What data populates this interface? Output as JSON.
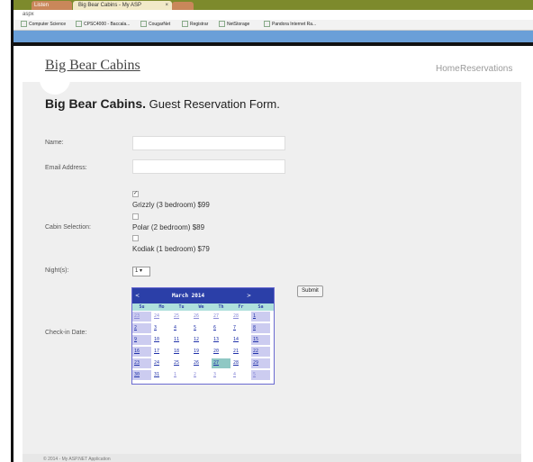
{
  "browser": {
    "tab_left_label": "Listen",
    "tab_active_label": "Big Bear Cabins - My ASP",
    "tab_close": "×",
    "url_text": "aspx",
    "favorites": [
      {
        "label": "Computer Science"
      },
      {
        "label": "CPSC4000 - Baccala..."
      },
      {
        "label": "CougarNet"
      },
      {
        "label": "Registrar"
      },
      {
        "label": "NetStorage"
      },
      {
        "label": "Pandora Internet Ra..."
      }
    ]
  },
  "site": {
    "title": "Big Bear Cabins",
    "nav": {
      "home": "Home",
      "reservations": "Reservations"
    }
  },
  "form": {
    "heading_bold": "Big Bear Cabins.",
    "heading_rest": " Guest Reservation Form.",
    "name_label": "Name:",
    "email_label": "Email Address:",
    "cabin_label": "Cabin Selection:",
    "cabins": [
      {
        "label": "Grizzly (3 bedroom) $99",
        "checked": true
      },
      {
        "label": "Polar (2 bedroom) $89",
        "checked": false
      },
      {
        "label": "Kodiak (1 bedroom) $79",
        "checked": false
      }
    ],
    "nights_label": "Night(s):",
    "nights_value": "1 ▾",
    "checkin_label": "Check-in Date:",
    "submit_label": "Submit"
  },
  "calendar": {
    "prev": "<",
    "next": ">",
    "title": "March 2014",
    "dows": [
      "Su",
      "Mo",
      "Tu",
      "We",
      "Th",
      "Fr",
      "Sa"
    ],
    "weeks": [
      [
        "23",
        "24",
        "25",
        "26",
        "27",
        "28",
        "1"
      ],
      [
        "2",
        "3",
        "4",
        "5",
        "6",
        "7",
        "8"
      ],
      [
        "9",
        "10",
        "11",
        "12",
        "13",
        "14",
        "15"
      ],
      [
        "16",
        "17",
        "18",
        "19",
        "20",
        "21",
        "22"
      ],
      [
        "23",
        "24",
        "25",
        "26",
        "27",
        "28",
        "29"
      ],
      [
        "30",
        "31",
        "1",
        "2",
        "3",
        "4",
        "5"
      ]
    ],
    "today": "27"
  },
  "footer": {
    "text": "© 2014 - My ASP.NET Application"
  }
}
